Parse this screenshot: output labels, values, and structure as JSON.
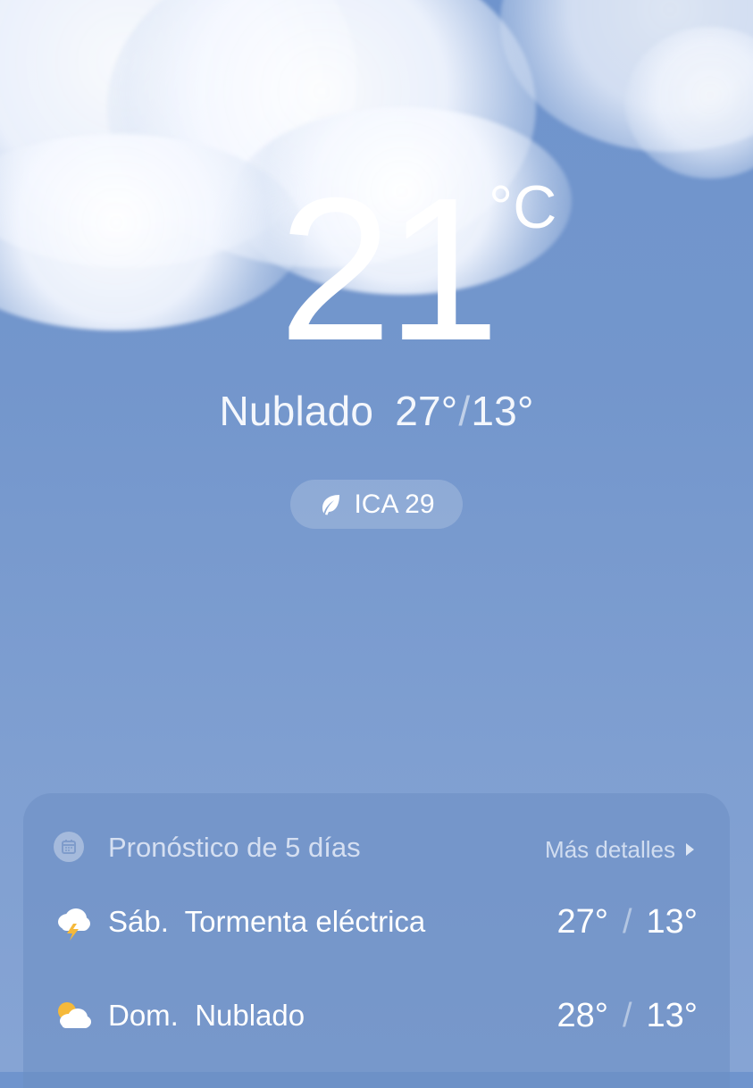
{
  "current": {
    "temperature": "21",
    "unit": "°C",
    "condition": "Nublado",
    "high": "27°",
    "low": "13°",
    "separator": "/"
  },
  "air_quality": {
    "label": "ICA 29",
    "icon": "leaf-icon"
  },
  "forecast": {
    "title": "Pronóstico de 5 días",
    "more_label": "Más detalles",
    "icon": "calendar-icon",
    "days": [
      {
        "day": "Sáb.",
        "condition": "Tormenta eléctrica",
        "high": "27°",
        "low": "13°",
        "icon": "thunderstorm-icon"
      },
      {
        "day": "Dom.",
        "condition": "Nublado",
        "high": "28°",
        "low": "13°",
        "icon": "partly-cloudy-icon"
      }
    ]
  },
  "colors": {
    "sky": "#7396cc",
    "card": "#6c8ec2",
    "text": "#ffffff",
    "sun": "#f5b93a"
  }
}
